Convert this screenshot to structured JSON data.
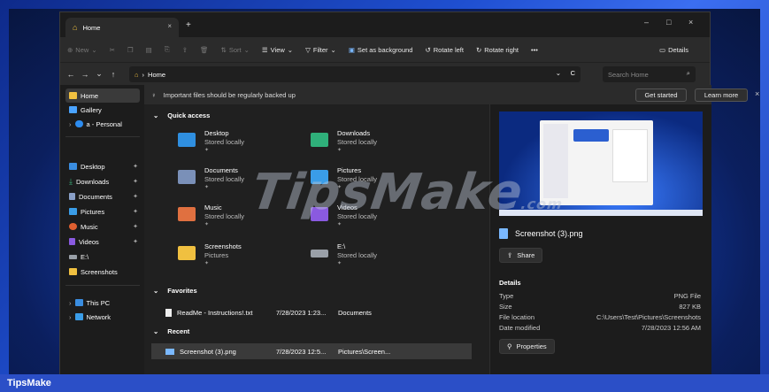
{
  "tab": {
    "title": "Home",
    "close": "×",
    "new": "+"
  },
  "window_controls": {
    "minimize": "–",
    "maximize": "□",
    "close": "×"
  },
  "toolbar": {
    "new": "New",
    "sort": "Sort",
    "view": "View",
    "filter": "Filter",
    "set_background": "Set as background",
    "rotate_left": "Rotate left",
    "rotate_right": "Rotate right",
    "more": "•••",
    "details": "Details"
  },
  "address": {
    "back": "←",
    "forward": "→",
    "recent": "⌄",
    "up": "↑",
    "crumb_sep": "›",
    "crumb": "Home",
    "dropdown": "⌄",
    "refresh": "C",
    "search_placeholder": "Search Home"
  },
  "sidebar": {
    "top": [
      {
        "label": "Home",
        "color": "#f0c040"
      },
      {
        "label": "Gallery",
        "color": "#4aa3ff"
      },
      {
        "label": "a - Personal",
        "color": "#2d8cf0"
      }
    ],
    "pinned": [
      {
        "label": "Desktop",
        "color": "#3a8de0"
      },
      {
        "label": "Downloads",
        "color": "#3ab07a"
      },
      {
        "label": "Documents",
        "color": "#8aa0c8"
      },
      {
        "label": "Pictures",
        "color": "#3a9de8"
      },
      {
        "label": "Music",
        "color": "#e06030"
      },
      {
        "label": "Videos",
        "color": "#8a5ae0"
      },
      {
        "label": "E:\\",
        "color": "#9aa0a8"
      },
      {
        "label": "Screenshots",
        "color": "#f0c040"
      }
    ],
    "drives": [
      {
        "label": "This PC",
        "color": "#3a8de0"
      },
      {
        "label": "Network",
        "color": "#3a9de8"
      }
    ]
  },
  "banner": {
    "text": "Important files should be regularly backed up",
    "get_started": "Get started",
    "learn_more": "Learn more",
    "close": "×"
  },
  "main": {
    "quick_access": "Quick access",
    "favorites": "Favorites",
    "recent": "Recent",
    "folders": [
      {
        "name": "Desktop",
        "status": "Stored locally",
        "color": "#2f8fe0"
      },
      {
        "name": "Downloads",
        "status": "Stored locally",
        "color": "#2fb07a"
      },
      {
        "name": "Documents",
        "status": "Stored locally",
        "color": "#7a90b8"
      },
      {
        "name": "Pictures",
        "status": "Stored locally",
        "color": "#3a9de8"
      },
      {
        "name": "Music",
        "status": "Stored locally",
        "color": "#e07040"
      },
      {
        "name": "Videos",
        "status": "Stored locally",
        "color": "#8a5ae0"
      },
      {
        "name": "Screenshots",
        "status": "Pictures",
        "color": "#f0c040"
      },
      {
        "name": "E:\\",
        "status": "Stored locally",
        "color": "#9aa0a8"
      }
    ],
    "favorite_files": [
      {
        "name": "ReadMe - Instructions!.txt",
        "date": "7/28/2023 1:23...",
        "location": "Documents"
      }
    ],
    "recent_files": [
      {
        "name": "Screenshot (3).png",
        "date": "7/28/2023 12:5...",
        "location": "Pictures\\Screen..."
      }
    ]
  },
  "preview": {
    "filename": "Screenshot (3).png",
    "share": "Share",
    "details_title": "Details",
    "details": [
      {
        "label": "Type",
        "value": "PNG File"
      },
      {
        "label": "Size",
        "value": "827 KB"
      },
      {
        "label": "File location",
        "value": "C:\\Users\\Test\\Pictures\\Screenshots"
      },
      {
        "label": "Date modified",
        "value": "7/28/2023 12:56 AM"
      }
    ],
    "properties": "Properties"
  },
  "watermark": {
    "main": "TipsMake",
    "suffix": ".com"
  },
  "footer": {
    "brand": "TipsMake"
  }
}
